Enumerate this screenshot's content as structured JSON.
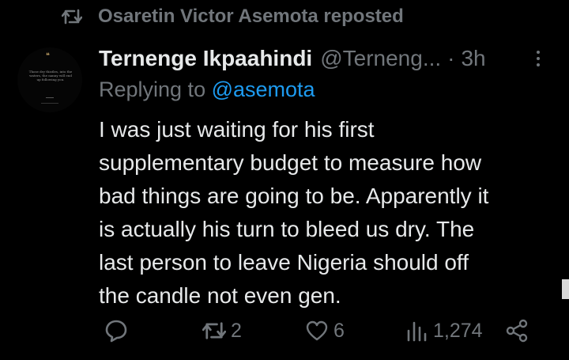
{
  "repost": {
    "text": "Osaretin Victor Asemota reposted",
    "icon": "repost-icon"
  },
  "post": {
    "author_name": "Ternenge Ikpaahindi",
    "handle": "@Terneng...",
    "separator": "·",
    "time": "3h",
    "replying_prefix": "Replying to ",
    "replying_handle": "@asemota",
    "body_lines": [
      "I was just waiting for his first",
      "supplementary budget to measure how",
      "bad things are going to be. Apparently it",
      "is actually his turn to bleed us dry. The",
      "last person to leave Nigeria should off",
      "the candle not even gen."
    ]
  },
  "actions": {
    "reply_count": "",
    "repost_count": "2",
    "like_count": "6",
    "views_count": "1,274"
  },
  "avatar": {
    "quote_mark": "❝",
    "lines": "Those dry thistles, into the waters, the nanny will end up following you."
  },
  "colors": {
    "background": "#000000",
    "text": "#e7e9ea",
    "muted": "#71767b",
    "link": "#1d9bf0"
  }
}
